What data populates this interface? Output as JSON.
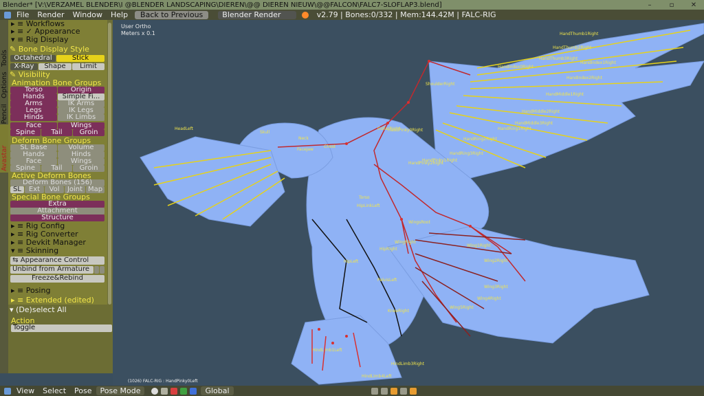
{
  "window": {
    "title": "Blender* [V:\\VERZAMEL BLENDER\\I @BLENDER LANDSCAPING\\DIEREN\\@@ DIEREN NIEUW\\@@FALCON\\FALC7-SLOFLAP3.blend]",
    "minimize": "–",
    "restore": "▫",
    "close": "✕"
  },
  "menubar": {
    "items": [
      "File",
      "Render",
      "Window",
      "Help"
    ],
    "back_button": "Back to Previous",
    "engine": "Blender Render",
    "stats": "v2.79 | Bones:0/332  | Mem:144.42M | FALC-RIG"
  },
  "tabs": [
    "Tools",
    "Options",
    "Grease Pencil",
    "Avastar"
  ],
  "panel": {
    "workflows": "Workflows",
    "appearance": "Appearance",
    "rig_display": "Rig Display",
    "bone_display_style": "Bone Display Style",
    "octahedral": "Octahedral",
    "stick": "Stick",
    "xray": "X-Ray",
    "shape": "Shape",
    "limit": "Limit",
    "visibility": "Visibility",
    "animation_bone_groups": "Animation Bone Groups",
    "torso": "Torso",
    "origin": "Origin",
    "hands": "Hands",
    "simple_fi": "Simple Fi...",
    "arms": "Arms",
    "ik_arms": "IK Arms",
    "legs": "Legs",
    "ik_legs": "IK Legs",
    "hinds": "Hinds",
    "ik_limbs": "IK Limbs",
    "face": "Face",
    "wings": "Wings",
    "spine": "Spine",
    "tail": "Tail",
    "groin": "Groin",
    "deform_bone_groups": "Deform Bone Groups",
    "sl_base": "SL Base",
    "volume": "Volume",
    "d_hands": "Hands",
    "d_hinds": "Hinds",
    "d_face": "Face",
    "d_wings": "Wings",
    "d_spine": "Spine",
    "d_tail": "Tail",
    "d_groin": "Groin",
    "active_deform_bones": "Active Deform Bones",
    "deform_bones": "Deform Bones (156)",
    "sl": "SL",
    "ext": "Ext",
    "vol": "Vol",
    "joint": "Joint",
    "map": "Map",
    "special_bone_groups": "Special Bone Groups",
    "extra": "Extra",
    "attachment": "Attachment",
    "structure": "Structure",
    "rig_config": "Rig Config",
    "rig_converter": "Rig Converter",
    "devkit_manager": "Devkit Manager",
    "skinning": "Skinning",
    "appearance_control": "Appearance Control",
    "unbind": "Unbind from Armature",
    "freeze": "Freeze&Rebind",
    "posing": "Posing",
    "extended": "Extended (edited)"
  },
  "subpanel": {
    "deselect": "(De)select All",
    "action": "Action",
    "toggle": "Toggle"
  },
  "viewport": {
    "view_label": "User Ortho",
    "units_label": "Meters x 0.1",
    "status": "(1026) FALC-RIG : HandPinky0Left",
    "bone_labels": [
      "HandThumb1Right",
      "HandThumb2Right",
      "HandThumb3Right",
      "HandIndex0Right",
      "HandIndex1Right",
      "HandIndex2Right",
      "ShoulderRight",
      "HandMiddle1Right",
      "HandMiddle2Right",
      "HandMiddle3Right",
      "HandRing1Right",
      "HandRing2Right",
      "HandRing3Right",
      "HandPinky0Right",
      "HandPinky1Right",
      "HandPinky2Right",
      "Skull",
      "Neck",
      "Chest",
      "Torso",
      "HipLinkLeft",
      "WingsRoot",
      "Wing1Right",
      "Wing2Right",
      "Wing3Right",
      "Wing4Right",
      "Wing5Right",
      "HipRight",
      "HipLeft",
      "KneeRight",
      "HindLimb1Left",
      "HindLimb3Right",
      "HindLimb4Left",
      "WingRight",
      "CollarRight",
      "HeadLeft",
      "FaceJaw",
      "PelvisLeft"
    ]
  },
  "footer": {
    "view": "View",
    "select": "Select",
    "pose": "Pose",
    "mode": "Pose Mode",
    "orientation": "Global"
  },
  "colors": {
    "title_bg": "#7f8f6a",
    "menu_bg": "#4a4d36",
    "panel_bg": "#7f7f36",
    "viewport_bg": "#3b4f60",
    "accent_yellow": "#f2e64a",
    "pink_button": "#7c2f5a",
    "bird": "#8fb2f5",
    "bone_red": "#c0292e",
    "bone_yellow": "#e6d21a"
  }
}
